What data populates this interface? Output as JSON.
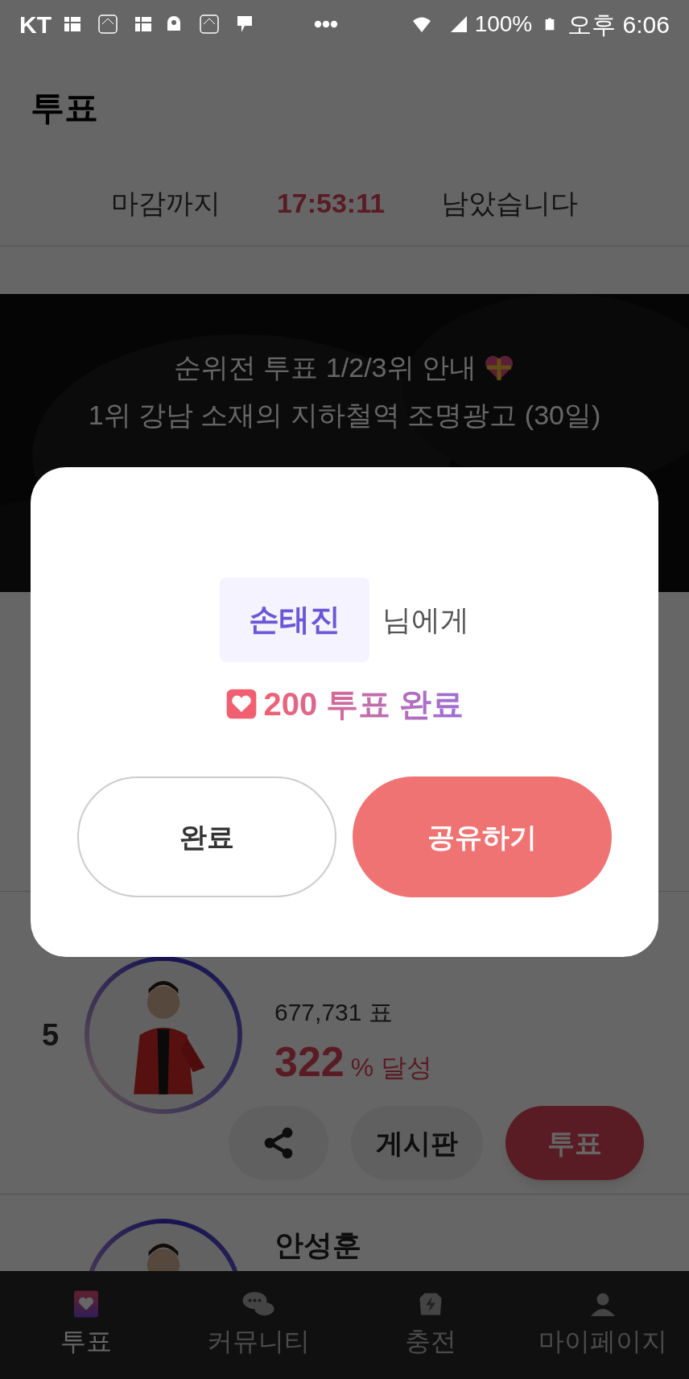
{
  "status_bar": {
    "carrier": "KT",
    "battery": "100%",
    "time": "오후 6:06"
  },
  "header": {
    "title": "투표"
  },
  "countdown": {
    "before": "마감까지",
    "time": "17:53:11",
    "after": "남았습니다"
  },
  "banner": {
    "lines": [
      "순위전 투표 1/2/3위 안내",
      "1위 강남 소재의 지하철역 조명광고 (30일)"
    ]
  },
  "rows": [
    {
      "rank": "5",
      "votes": "677,731 표",
      "percent": "322",
      "percent_suffix": "% 달성",
      "actions": {
        "board": "게시판",
        "vote": "투표"
      }
    },
    {
      "name": "안성훈"
    }
  ],
  "dialog": {
    "name": "손태진",
    "suffix": "님에게",
    "result": "200 투표 완료",
    "buttons": [
      {
        "label": "완료",
        "kind": "secondary"
      },
      {
        "label": "공유하기",
        "kind": "primary"
      }
    ]
  },
  "nav": [
    {
      "label": "투표",
      "selected": true
    },
    {
      "label": "커뮤니티",
      "selected": false
    },
    {
      "label": "충전",
      "selected": false
    },
    {
      "label": "마이페이지",
      "selected": false
    }
  ]
}
